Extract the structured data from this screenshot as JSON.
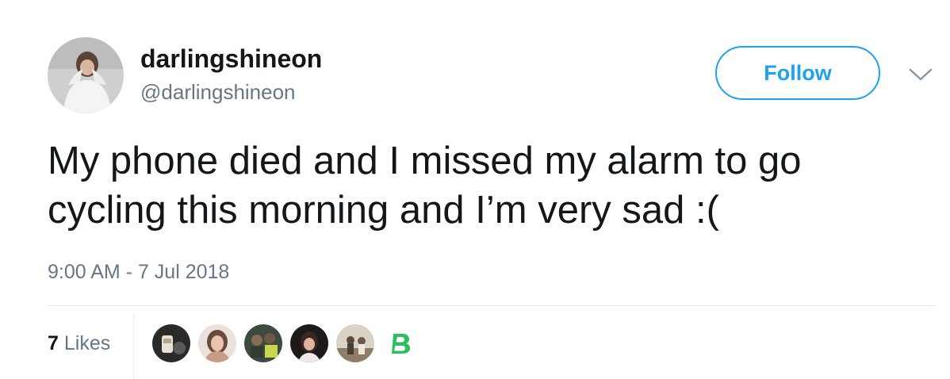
{
  "author": {
    "display_name": "darlingshineon",
    "handle": "@darlingshineon",
    "avatar_icon": "profile-photo"
  },
  "follow_button": {
    "label": "Follow",
    "color": "#1da1f2"
  },
  "menu": {
    "icon": "chevron-down-icon"
  },
  "tweet": {
    "text": "My phone died and I missed my alarm to go\ncycling this morning and I’m very sad :(",
    "timestamp": "9:00 AM - 7 Jul 2018"
  },
  "stats": {
    "likes_count": "7",
    "likes_label": "Likes"
  },
  "likers": [
    {
      "icon": "liker-avatar-1"
    },
    {
      "icon": "liker-avatar-2"
    },
    {
      "icon": "liker-avatar-3"
    },
    {
      "icon": "liker-avatar-4"
    },
    {
      "icon": "liker-avatar-5"
    },
    {
      "icon": "liker-avatar-6"
    },
    {
      "icon": "liker-avatar-7-b-logo",
      "color": "#2dbe60"
    }
  ],
  "colors": {
    "text_primary": "#14171a",
    "text_secondary": "#657786",
    "divider": "#e6ecf0",
    "accent": "#1da1f2"
  }
}
